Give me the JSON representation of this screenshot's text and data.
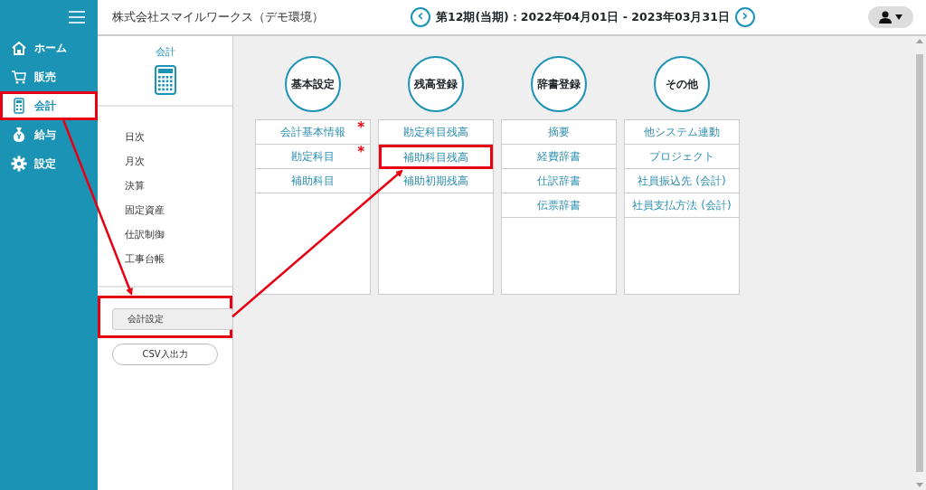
{
  "header": {
    "company": "株式会社スマイルワークス（デモ環境）",
    "period": "第12期(当期)：2022年04月01日 - 2023年03月31日",
    "prev_label": "‹",
    "next_label": "›"
  },
  "sidebar": {
    "items": [
      {
        "label": "ホーム",
        "selected": false,
        "highlighted": false
      },
      {
        "label": "販売",
        "selected": false,
        "highlighted": false
      },
      {
        "label": "会計",
        "selected": true,
        "highlighted": true
      },
      {
        "label": "給与",
        "selected": false,
        "highlighted": false
      },
      {
        "label": "設定",
        "selected": false,
        "highlighted": false
      }
    ]
  },
  "submenu": {
    "title": "会計",
    "items": [
      "日次",
      "月次",
      "決算",
      "固定資産",
      "仕訳制御",
      "工事台帳"
    ],
    "buttons": [
      {
        "label": "会計設定",
        "kind": "tab",
        "selected": true,
        "highlighted": true
      },
      {
        "label": "CSV入出力",
        "kind": "outline",
        "selected": false,
        "highlighted": false
      }
    ]
  },
  "groups": [
    {
      "title": "基本設定",
      "items": [
        {
          "label": "会計基本情報",
          "required": true,
          "highlighted": false
        },
        {
          "label": "勘定科目",
          "required": true,
          "highlighted": false
        },
        {
          "label": "補助科目",
          "required": false,
          "highlighted": false
        }
      ]
    },
    {
      "title": "残高登録",
      "items": [
        {
          "label": "勘定科目残高",
          "required": false,
          "highlighted": false
        },
        {
          "label": "補助科目残高",
          "required": false,
          "highlighted": true
        },
        {
          "label": "補助初期残高",
          "required": false,
          "highlighted": false
        }
      ]
    },
    {
      "title": "辞書登録",
      "items": [
        {
          "label": "摘要",
          "required": false,
          "highlighted": false
        },
        {
          "label": "経費辞書",
          "required": false,
          "highlighted": false
        },
        {
          "label": "仕訳辞書",
          "required": false,
          "highlighted": false
        },
        {
          "label": "伝票辞書",
          "required": false,
          "highlighted": false
        }
      ]
    },
    {
      "title": "その他",
      "items": [
        {
          "label": "他システム連動",
          "required": false,
          "highlighted": false
        },
        {
          "label": "プロジェクト",
          "required": false,
          "highlighted": false
        },
        {
          "label": "社員振込先 (会計)",
          "required": false,
          "highlighted": false
        },
        {
          "label": "社員支払方法 (会計)",
          "required": false,
          "highlighted": false
        }
      ]
    }
  ],
  "required_mark": "*"
}
